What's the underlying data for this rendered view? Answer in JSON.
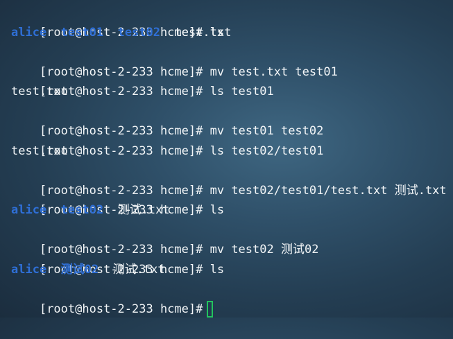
{
  "terminal": {
    "prompt": "[root@host-2-233 hcme]#",
    "colors": {
      "directory": "#2f6fd6",
      "text": "#f2f5f7",
      "cursor": "#23c45e",
      "background": "#2f5069"
    },
    "lines": [
      {
        "type": "command",
        "command": "ls"
      },
      {
        "type": "listing",
        "items": [
          {
            "name": "alice",
            "kind": "dir"
          },
          {
            "name": "test01",
            "kind": "dir"
          },
          {
            "name": "test02",
            "kind": "dir"
          },
          {
            "name": "test.txt",
            "kind": "file"
          }
        ]
      },
      {
        "type": "command",
        "command": "mv test.txt test01"
      },
      {
        "type": "command",
        "command": "ls test01"
      },
      {
        "type": "output",
        "text": "test.txt"
      },
      {
        "type": "command",
        "command": "mv test01 test02"
      },
      {
        "type": "command",
        "command": "ls test02/test01"
      },
      {
        "type": "output",
        "text": "test.txt"
      },
      {
        "type": "command",
        "command": "mv test02/test01/test.txt 测试.txt"
      },
      {
        "type": "command",
        "command": "ls"
      },
      {
        "type": "listing",
        "items": [
          {
            "name": "alice",
            "kind": "dir"
          },
          {
            "name": "test02",
            "kind": "dir"
          },
          {
            "name": "测试.txt",
            "kind": "file"
          }
        ]
      },
      {
        "type": "command",
        "command": "mv test02 测试02"
      },
      {
        "type": "command",
        "command": "ls"
      },
      {
        "type": "listing",
        "items": [
          {
            "name": "alice",
            "kind": "dir"
          },
          {
            "name": "测试02",
            "kind": "dir"
          },
          {
            "name": "测试.txt",
            "kind": "file"
          }
        ]
      },
      {
        "type": "prompt",
        "command": ""
      }
    ]
  }
}
